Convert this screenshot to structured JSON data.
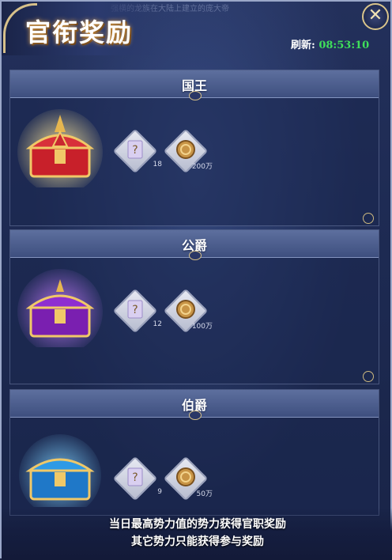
{
  "header": {
    "banner_text": "强横的龙族在大陆上建立的庞大帝",
    "title": "官衔奖励",
    "refresh_label": "刷新:",
    "refresh_time": "08:53:10",
    "close_icon": "close-icon"
  },
  "sections": [
    {
      "title": "国王",
      "chest_color": "#c8202a",
      "chest_glow": "#ffe89a",
      "items": [
        {
          "icon": "scroll-card-icon",
          "count": "18"
        },
        {
          "icon": "gold-coin-icon",
          "count": "200万"
        }
      ]
    },
    {
      "title": "公爵",
      "chest_color": "#7a1fb0",
      "chest_glow": "#c67bff",
      "items": [
        {
          "icon": "scroll-card-icon",
          "count": "12"
        },
        {
          "icon": "gold-coin-icon",
          "count": "100万"
        }
      ]
    },
    {
      "title": "伯爵",
      "chest_color": "#1f78c8",
      "chest_glow": "#7fd3ff",
      "items": [
        {
          "icon": "scroll-card-icon",
          "count": "9"
        },
        {
          "icon": "gold-coin-icon",
          "count": "50万"
        }
      ]
    }
  ],
  "footer": {
    "line1": "当日最高势力值的势力获得官职奖励",
    "line2": "其它势力只能获得参与奖励"
  }
}
